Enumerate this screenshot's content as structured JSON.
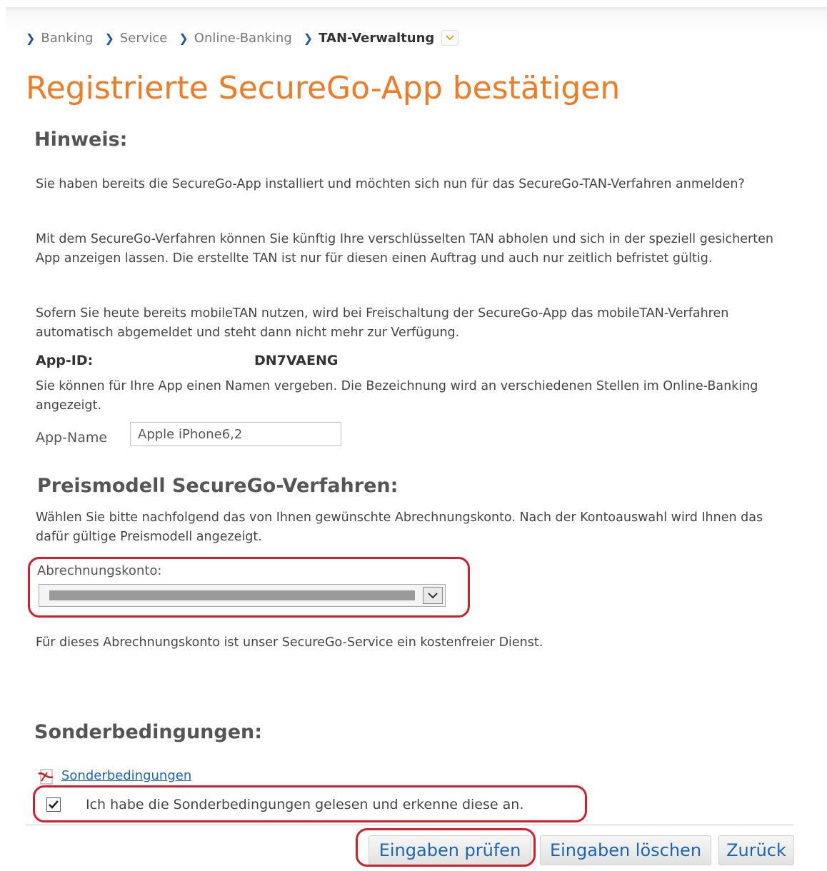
{
  "breadcrumb": {
    "items": [
      "Banking",
      "Service",
      "Online-Banking",
      "TAN-Verwaltung"
    ]
  },
  "page": {
    "title": "Registrierte SecureGo-App bestätigen"
  },
  "hinweis": {
    "heading": "Hinweis:",
    "p1": "Sie haben bereits die SecureGo-App installiert und möchten sich nun für das SecureGo-TAN-Verfahren anmelden?",
    "p2": "Mit dem SecureGo-Verfahren können Sie künftig Ihre verschlüsselten TAN abholen und sich in der speziell gesicherten App anzeigen lassen. Die erstellte TAN ist nur für diesen einen Auftrag und auch nur zeitlich befristet gültig.",
    "p3": "Sofern Sie heute bereits mobileTAN nutzen, wird bei Freischaltung der SecureGo-App das mobileTAN-Verfahren automatisch abgemeldet und steht dann nicht mehr zur Verfügung."
  },
  "app": {
    "id_label": "App-ID:",
    "id_value": "DN7VAENG",
    "name_hint": "Sie können für Ihre App einen Namen vergeben. Die Bezeichnung wird an verschiedenen Stellen im Online-Banking angezeigt.",
    "name_label": "App-Name",
    "name_value": "Apple iPhone6,2"
  },
  "preismodell": {
    "heading": "Preismodell SecureGo-Verfahren:",
    "description": "Wählen Sie bitte nachfolgend das von Ihnen gewünschte Abrechnungskonto. Nach der Kontoauswahl wird Ihnen das dafür gültige Preismodell angezeigt.",
    "select_label": "Abrechnungskonto:",
    "info": "Für dieses Abrechnungskonto ist unser SecureGo-Service ein kostenfreier Dienst."
  },
  "sonder": {
    "heading": "Sonderbedingungen:",
    "link": "Sonderbedingungen",
    "checkbox_label": "Ich habe die Sonderbedingungen gelesen und erkenne diese an.",
    "checked": true
  },
  "buttons": {
    "check": "Eingaben prüfen",
    "clear": "Eingaben löschen",
    "back": "Zurück"
  },
  "colors": {
    "title": "#ef7b24",
    "link": "#1a66b5",
    "highlight": "#d21f2f"
  }
}
